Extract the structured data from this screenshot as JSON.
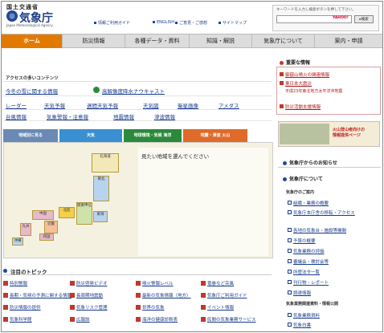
{
  "header": {
    "ministry": "国土交通省",
    "agency": "気象庁",
    "agency_en": "Japan Meteorological Agency",
    "search_hint": "キーワードを入力し検索ボタンを押して下さい。",
    "search_placeholder": "",
    "search_provider": "YAHOO!",
    "search_button": "検索",
    "links": [
      "情報ご利用ガイド",
      "ENGLISH",
      "ご意見・ご感想",
      "サイトマップ"
    ]
  },
  "nav": [
    "ホーム",
    "防災情報",
    "各種データ・資料",
    "知識・解説",
    "気象庁について",
    "案内・申請"
  ],
  "access": {
    "title": "アクセスの多いコンテンツ",
    "row1": [
      "今冬の雪に関する情報",
      "高解像度降水ナウキャスト"
    ],
    "row2": [
      "レーダー",
      "天気予報",
      "週間天気予報",
      "天気図",
      "衛星画像",
      "アメダス"
    ],
    "row3": [
      "台風情報",
      "気象警報・注意報",
      "地震情報",
      "津波情報"
    ]
  },
  "map": {
    "tabs": [
      "地域別に見る",
      "天気",
      "地球環境・気候 海洋",
      "地震・津波 火山"
    ],
    "tab_colors": [
      "#6b8ab3",
      "#3a8fd0",
      "#2b8a3a",
      "#e06a2a"
    ],
    "prompt": "見たい地域を選んでください",
    "regions": [
      "北海道",
      "東北",
      "北陸",
      "関東甲信",
      "東海",
      "近畿",
      "中国",
      "四国",
      "九州",
      "沖縄"
    ]
  },
  "topics": {
    "title": "注目のトピック",
    "items": [
      [
        "特別警報",
        "防災啓発ビデオ",
        "噴火警報レベル",
        "竜巻など突風"
      ],
      [
        "長期・気候の予測に関する情報",
        "長周期地震動",
        "最新の気象情報（地方）",
        "気象庁ご利用ガイド"
      ],
      [
        "防災情報の提供",
        "気象リスク管理",
        "世界の気象",
        "イベント情報"
      ],
      [
        "気象科学館",
        "広報誌",
        "海洋の健康診断表",
        "民間の気象業務サービス"
      ]
    ]
  },
  "sidebar": {
    "important_title": "重要な情報",
    "important_links": [
      "御嶽山噴火の関連情報",
      "東日本大震災",
      "平成23年東北地方太平洋沖地震",
      "防災活動支援情報"
    ],
    "banner_text": [
      "火山登山者向けの",
      "情報提供ページ"
    ],
    "news_title": "気象庁からのお知らせ",
    "about_title": "気象庁について",
    "about_sub": "気象庁のご案内",
    "about_links": [
      "組織・業務の概要",
      "気象庁本庁舎の移転・アクセス",
      "各地の気象台・施設等機関",
      "予算の概要",
      "気象業務の評価",
      "審議会・検討会等",
      "所管法令一覧",
      "刊行物・レポート",
      "調達情報"
    ],
    "library_sub": "気象業務関連資料・情報公開",
    "library_links": [
      "気象業務資料",
      "気象白書"
    ]
  }
}
